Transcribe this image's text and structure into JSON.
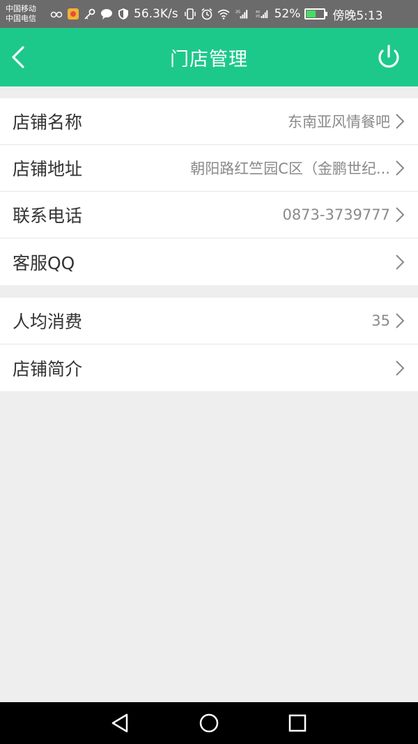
{
  "status_bar": {
    "carrier_1": "中国移动",
    "carrier_2": "中国电信",
    "speed": "56.3K/s",
    "battery_percent": "52%",
    "battery_level": 0.52,
    "time": "傍晚5:13",
    "icons": [
      "glasses-icon",
      "app-icon",
      "key-icon",
      "chat-icon",
      "shield-icon",
      "vibrate-icon",
      "alarm-icon",
      "wifi-icon",
      "signal-2g-icon",
      "signal-4g-icon"
    ],
    "network_2g": "2G",
    "network_4g": "4G",
    "network_2g_b": "2G"
  },
  "header": {
    "title": "门店管理",
    "back_icon": "back-arrow-icon",
    "power_icon": "power-icon",
    "color": "#1dc98a"
  },
  "settings": {
    "group_1": [
      {
        "label": "店铺名称",
        "value": "东南亚风情餐吧"
      },
      {
        "label": "店铺地址",
        "value": "朝阳路红竺园C区（金鹏世纪..."
      },
      {
        "label": "联系电话",
        "value": "0873-3739777"
      },
      {
        "label": "客服QQ",
        "value": ""
      }
    ],
    "group_2": [
      {
        "label": "人均消费",
        "value": "35"
      },
      {
        "label": "店铺简介",
        "value": ""
      }
    ]
  },
  "nav_bar": {
    "icons": [
      "back-triangle-icon",
      "home-circle-icon",
      "recents-square-icon"
    ]
  }
}
